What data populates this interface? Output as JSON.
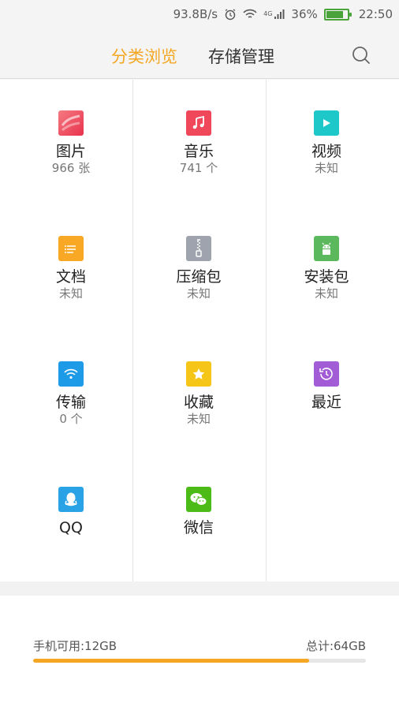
{
  "status_bar": {
    "speed": "93.8B/s",
    "network": "4G",
    "battery": "36%",
    "time": "22:50"
  },
  "header": {
    "tabs": [
      {
        "label": "分类浏览",
        "active": true
      },
      {
        "label": "存储管理",
        "active": false
      }
    ],
    "search_icon": "search-icon"
  },
  "categories": [
    {
      "label": "图片",
      "sub": "966 张",
      "icon": "image-icon",
      "color": "#f04e5e"
    },
    {
      "label": "音乐",
      "sub": "741 个",
      "icon": "music-icon",
      "color": "#f0475b"
    },
    {
      "label": "视频",
      "sub": "未知",
      "icon": "video-icon",
      "color": "#1ec8c8"
    },
    {
      "label": "文档",
      "sub": "未知",
      "icon": "document-icon",
      "color": "#f9a825"
    },
    {
      "label": "压缩包",
      "sub": "未知",
      "icon": "zip-icon",
      "color": "#9ea3ad"
    },
    {
      "label": "安装包",
      "sub": "未知",
      "icon": "android-apk-icon",
      "color": "#5cb85c"
    },
    {
      "label": "传输",
      "sub": "0 个",
      "icon": "wifi-transfer-icon",
      "color": "#1e9be6"
    },
    {
      "label": "收藏",
      "sub": "未知",
      "icon": "star-icon",
      "color": "#f5c518"
    },
    {
      "label": "最近",
      "sub": "",
      "icon": "history-icon",
      "color": "#a25cd6"
    },
    {
      "label": "QQ",
      "sub": "",
      "icon": "qq-icon",
      "color": "#29a3e6"
    },
    {
      "label": "微信",
      "sub": "",
      "icon": "wechat-icon",
      "color": "#4cbb17"
    }
  ],
  "storage": {
    "available": "手机可用:12GB",
    "total": "总计:64GB",
    "used_fraction": 0.83,
    "bar_color": "#f5a623"
  }
}
